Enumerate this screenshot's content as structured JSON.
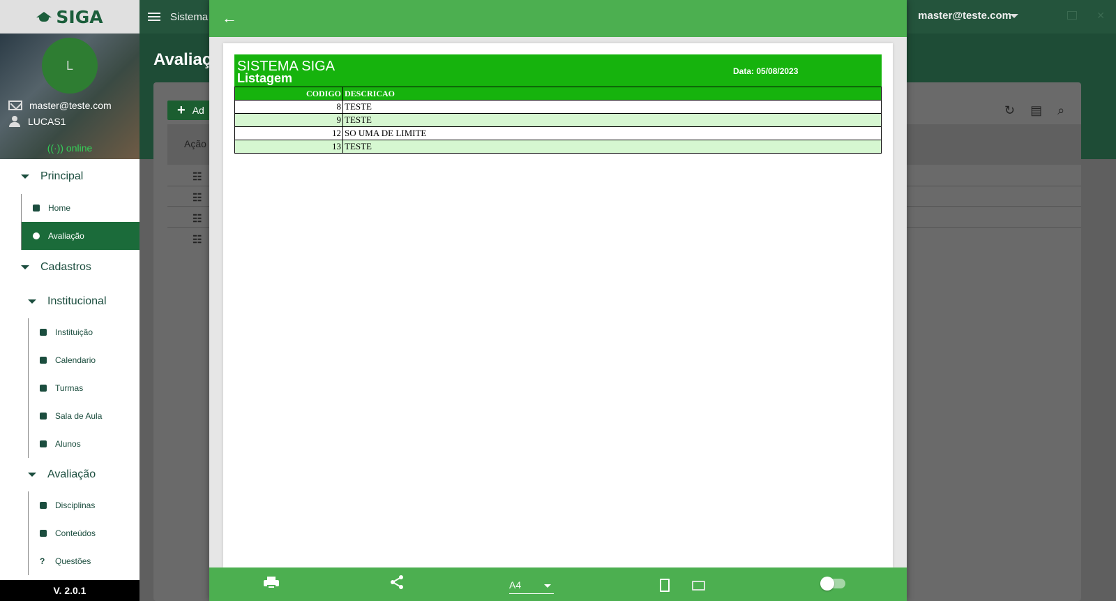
{
  "app": {
    "logo": "SIGA",
    "version": "V. 2.0.1",
    "topbar_title": "Sistema g",
    "topbar_user": "master@teste.com",
    "page_title": "Avaliaç",
    "add_button": "Ad",
    "column_acao": "Ação"
  },
  "profile": {
    "avatar_letter": "L",
    "email": "master@teste.com",
    "username": "LUCAS1",
    "status": "online"
  },
  "sidebar": {
    "group_principal": "Principal",
    "item_home": "Home",
    "item_avaliacao": "Avaliação",
    "group_cadastros": "Cadastros",
    "sub_institucional": "Institucional",
    "item_instituicao": "Instituição",
    "item_calendario": "Calendario",
    "item_turmas": "Turmas",
    "item_sala": "Sala de Aula",
    "item_alunos": "Alunos",
    "sub_avaliacao": "Avaliação",
    "item_disciplinas": "Disciplinas",
    "item_conteudos": "Conteúdos",
    "item_questoes": "Questões"
  },
  "report": {
    "system": "SISTEMA SIGA",
    "subtitle": "Listagem",
    "date": "Data: 05/08/2023",
    "col_codigo": "CODIGO",
    "col_descricao": "DESCRICAO",
    "rows": [
      {
        "codigo": "8",
        "descricao": "TESTE"
      },
      {
        "codigo": "9",
        "descricao": "TESTE"
      },
      {
        "codigo": "12",
        "descricao": "SO UMA DE LIMITE"
      },
      {
        "codigo": "13",
        "descricao": "TESTE"
      }
    ]
  },
  "preview_toolbar": {
    "page_size": "A4"
  },
  "colors": {
    "toolbar_green": "#4caf50",
    "report_header_green": "#16b30d",
    "alt_row": "#d6f7d1",
    "sidebar_active": "#1b6b3a"
  },
  "icons": [
    "back-arrow-icon",
    "print-icon",
    "share-icon",
    "portrait-icon",
    "landscape-icon",
    "toggle-switch"
  ]
}
